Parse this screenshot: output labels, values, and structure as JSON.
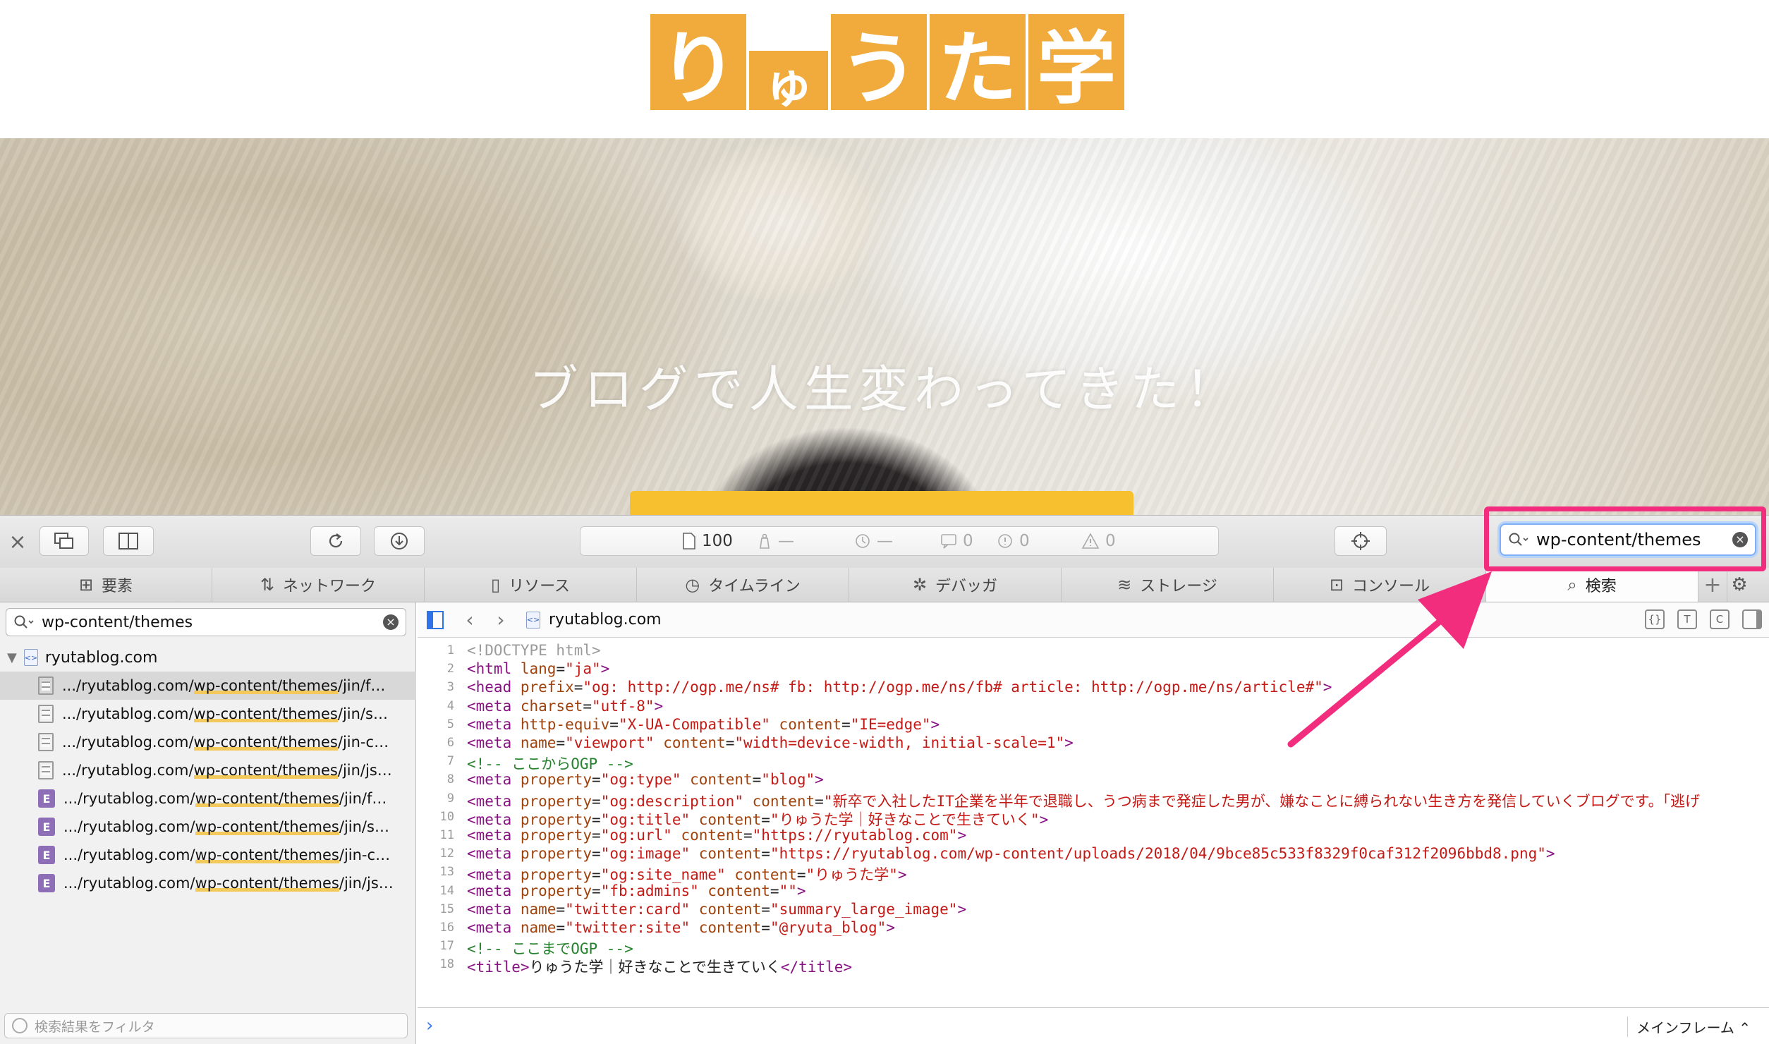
{
  "site": {
    "logo_chars": [
      "り",
      "ゅ",
      "う",
      "た",
      "学"
    ],
    "hero_catch": "ブログで人生変わってきた！",
    "brand_color": "#f0ab3c",
    "accent_button_color": "#f7c02e"
  },
  "toolbar": {
    "icons": [
      "close-icon",
      "pip-icon",
      "dock-side-icon",
      "reload-icon",
      "download-icon",
      "target-icon",
      "search-icon"
    ],
    "resources_count": "100",
    "lock_value": "—",
    "time_value": "—",
    "logs_count": "0",
    "errors_count": "0",
    "warnings_count": "0",
    "search_value": "wp-content/themes",
    "highlight_color": "#f22d7d"
  },
  "tabs": [
    {
      "label": "要素",
      "icon": "elements-icon"
    },
    {
      "label": "ネットワーク",
      "icon": "network-icon"
    },
    {
      "label": "リソース",
      "icon": "resources-icon"
    },
    {
      "label": "タイムライン",
      "icon": "timeline-icon"
    },
    {
      "label": "デバッガ",
      "icon": "debugger-icon"
    },
    {
      "label": "ストレージ",
      "icon": "storage-icon"
    },
    {
      "label": "コンソール",
      "icon": "console-icon"
    },
    {
      "label": "検索",
      "icon": "search-icon"
    }
  ],
  "left_panel": {
    "search_value": "wp-content/themes",
    "root": "ryutablog.com",
    "results": [
      {
        "type": "doc",
        "prefix": ".../ryutablog.com/",
        "match": "wp-content/themes",
        "suffix": "/jin/favi..."
      },
      {
        "type": "doc",
        "prefix": ".../ryutablog.com/",
        "match": "wp-content/themes",
        "suffix": "/jin/styl..."
      },
      {
        "type": "doc",
        "prefix": ".../ryutablog.com/",
        "match": "wp-content/themes",
        "suffix": "/jin-chil..."
      },
      {
        "type": "doc",
        "prefix": ".../ryutablog.com/",
        "match": "wp-content/themes",
        "suffix": "/jin/js/c..."
      },
      {
        "type": "element",
        "prefix": ".../ryutablog.com/",
        "match": "wp-content/themes",
        "suffix": "/jin/favi..."
      },
      {
        "type": "element",
        "prefix": ".../ryutablog.com/",
        "match": "wp-content/themes",
        "suffix": "/jin/styl..."
      },
      {
        "type": "element",
        "prefix": ".../ryutablog.com/",
        "match": "wp-content/themes",
        "suffix": "/jin-chil..."
      },
      {
        "type": "element",
        "prefix": ".../ryutablog.com/",
        "match": "wp-content/themes",
        "suffix": "/jin/js/c..."
      }
    ],
    "element_badge": "E",
    "filter_placeholder": "検索結果をフィルタ"
  },
  "source": {
    "file": "ryutablog.com",
    "file_badge": "<>",
    "view_buttons": [
      "{}",
      "T",
      "C",
      ""
    ],
    "nav_back": "‹",
    "nav_forward": "›",
    "lines": [
      {
        "n": "1",
        "parts": [
          [
            "doc",
            "<!DOCTYPE html>"
          ]
        ]
      },
      {
        "n": "2",
        "parts": [
          [
            "tag",
            "<html "
          ],
          [
            "attr",
            "lang"
          ],
          [
            "txt",
            "="
          ],
          [
            "str",
            "\"ja\""
          ],
          [
            "tag",
            ">"
          ]
        ]
      },
      {
        "n": "3",
        "parts": [
          [
            "tag",
            "<head "
          ],
          [
            "attr",
            "prefix"
          ],
          [
            "txt",
            "="
          ],
          [
            "str",
            "\"og: http://ogp.me/ns# fb: http://ogp.me/ns/fb# article: http://ogp.me/ns/article#\""
          ],
          [
            "tag",
            ">"
          ]
        ]
      },
      {
        "n": "4",
        "parts": [
          [
            "tag",
            "<meta "
          ],
          [
            "attr",
            "charset"
          ],
          [
            "txt",
            "="
          ],
          [
            "str",
            "\"utf-8\""
          ],
          [
            "tag",
            ">"
          ]
        ]
      },
      {
        "n": "5",
        "parts": [
          [
            "tag",
            "<meta "
          ],
          [
            "attr",
            "http-equiv"
          ],
          [
            "txt",
            "="
          ],
          [
            "str",
            "\"X-UA-Compatible\""
          ],
          [
            "txt",
            " "
          ],
          [
            "attr",
            "content"
          ],
          [
            "txt",
            "="
          ],
          [
            "str",
            "\"IE=edge\""
          ],
          [
            "tag",
            ">"
          ]
        ]
      },
      {
        "n": "6",
        "parts": [
          [
            "tag",
            "<meta "
          ],
          [
            "attr",
            "name"
          ],
          [
            "txt",
            "="
          ],
          [
            "str",
            "\"viewport\""
          ],
          [
            "txt",
            " "
          ],
          [
            "attr",
            "content"
          ],
          [
            "txt",
            "="
          ],
          [
            "str",
            "\"width=device-width, initial-scale=1\""
          ],
          [
            "tag",
            ">"
          ]
        ]
      },
      {
        "n": "7",
        "parts": [
          [
            "com",
            "<!-- ここからOGP -->"
          ]
        ]
      },
      {
        "n": "8",
        "parts": [
          [
            "tag",
            "<meta "
          ],
          [
            "attr",
            "property"
          ],
          [
            "txt",
            "="
          ],
          [
            "str",
            "\"og:type\""
          ],
          [
            "txt",
            " "
          ],
          [
            "attr",
            "content"
          ],
          [
            "txt",
            "="
          ],
          [
            "str",
            "\"blog\""
          ],
          [
            "tag",
            ">"
          ]
        ]
      },
      {
        "n": "9",
        "parts": [
          [
            "tag",
            "<meta "
          ],
          [
            "attr",
            "property"
          ],
          [
            "txt",
            "="
          ],
          [
            "str",
            "\"og:description\""
          ],
          [
            "txt",
            " "
          ],
          [
            "attr",
            "content"
          ],
          [
            "txt",
            "="
          ],
          [
            "str",
            "\"新卒で入社したIT企業を半年で退職し、うつ病まで発症した男が、嫌なことに縛られない生き方を発信していくブログです。「逃げ"
          ]
        ]
      },
      {
        "n": "10",
        "parts": [
          [
            "tag",
            "<meta "
          ],
          [
            "attr",
            "property"
          ],
          [
            "txt",
            "="
          ],
          [
            "str",
            "\"og:title\""
          ],
          [
            "txt",
            " "
          ],
          [
            "attr",
            "content"
          ],
          [
            "txt",
            "="
          ],
          [
            "str",
            "\"りゅうた学｜好きなことで生きていく\""
          ],
          [
            "tag",
            ">"
          ]
        ]
      },
      {
        "n": "11",
        "parts": [
          [
            "tag",
            "<meta "
          ],
          [
            "attr",
            "property"
          ],
          [
            "txt",
            "="
          ],
          [
            "str",
            "\"og:url\""
          ],
          [
            "txt",
            " "
          ],
          [
            "attr",
            "content"
          ],
          [
            "txt",
            "="
          ],
          [
            "str",
            "\"https://ryutablog.com\""
          ],
          [
            "tag",
            ">"
          ]
        ]
      },
      {
        "n": "12",
        "parts": [
          [
            "tag",
            "<meta "
          ],
          [
            "attr",
            "property"
          ],
          [
            "txt",
            "="
          ],
          [
            "str",
            "\"og:image\""
          ],
          [
            "txt",
            " "
          ],
          [
            "attr",
            "content"
          ],
          [
            "txt",
            "="
          ],
          [
            "str",
            "\"https://ryutablog.com/wp-content/uploads/2018/04/9bce85c533f8329f0caf312f2096bbd8.png\""
          ],
          [
            "tag",
            ">"
          ]
        ]
      },
      {
        "n": "13",
        "parts": [
          [
            "tag",
            "<meta "
          ],
          [
            "attr",
            "property"
          ],
          [
            "txt",
            "="
          ],
          [
            "str",
            "\"og:site_name\""
          ],
          [
            "txt",
            " "
          ],
          [
            "attr",
            "content"
          ],
          [
            "txt",
            "="
          ],
          [
            "str",
            "\"りゅうた学\""
          ],
          [
            "tag",
            ">"
          ]
        ]
      },
      {
        "n": "14",
        "parts": [
          [
            "tag",
            "<meta "
          ],
          [
            "attr",
            "property"
          ],
          [
            "txt",
            "="
          ],
          [
            "str",
            "\"fb:admins\""
          ],
          [
            "txt",
            " "
          ],
          [
            "attr",
            "content"
          ],
          [
            "txt",
            "="
          ],
          [
            "str",
            "\"\""
          ],
          [
            "tag",
            ">"
          ]
        ]
      },
      {
        "n": "15",
        "parts": [
          [
            "tag",
            "<meta "
          ],
          [
            "attr",
            "name"
          ],
          [
            "txt",
            "="
          ],
          [
            "str",
            "\"twitter:card\""
          ],
          [
            "txt",
            " "
          ],
          [
            "attr",
            "content"
          ],
          [
            "txt",
            "="
          ],
          [
            "str",
            "\"summary_large_image\""
          ],
          [
            "tag",
            ">"
          ]
        ]
      },
      {
        "n": "16",
        "parts": [
          [
            "tag",
            "<meta "
          ],
          [
            "attr",
            "name"
          ],
          [
            "txt",
            "="
          ],
          [
            "str",
            "\"twitter:site\""
          ],
          [
            "txt",
            " "
          ],
          [
            "attr",
            "content"
          ],
          [
            "txt",
            "="
          ],
          [
            "str",
            "\"@ryuta_blog\""
          ],
          [
            "tag",
            ">"
          ]
        ]
      },
      {
        "n": "17",
        "parts": [
          [
            "com",
            "<!-- ここまでOGP -->"
          ]
        ]
      },
      {
        "n": "18",
        "parts": [
          [
            "tag",
            "<title>"
          ],
          [
            "txt",
            "りゅうた学｜好きなことで生きていく"
          ],
          [
            "tag",
            "</title>"
          ]
        ]
      }
    ]
  },
  "console": {
    "prompt": "›",
    "frame_label": "メインフレーム",
    "frame_chevron": "⌃"
  }
}
